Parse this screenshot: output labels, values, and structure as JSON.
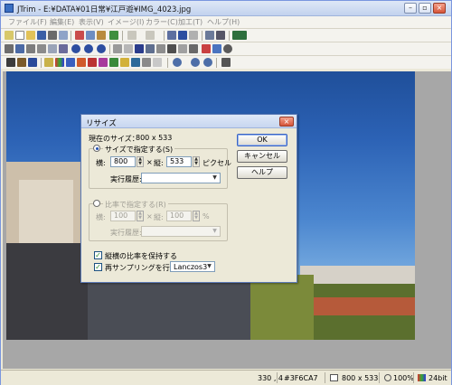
{
  "window": {
    "title": "JTrim - E:¥DATA¥01日常¥江戸遊¥IMG_4023.jpg"
  },
  "window_controls": {
    "minimize": "–",
    "maximize": "▫",
    "close": "×"
  },
  "menu": [
    "ファイル(F)",
    "編集(E)",
    "表示(V)",
    "イメージ(I)",
    "カラー(C)",
    "加工(T)",
    "ヘルプ(H)"
  ],
  "dialog": {
    "title": "リサイズ",
    "close": "×",
    "current_size_label": "現在のサイズ：",
    "current_size_value": "800 x 533",
    "size_group": {
      "radio_label": "サイズで指定する(S)",
      "width_label": "横:",
      "width_value": "800",
      "times": "×",
      "height_label": "縦:",
      "height_value": "533",
      "unit": "ピクセル",
      "history_label": "実行履歴:"
    },
    "ratio_group": {
      "radio_label": "比率で指定する(R)",
      "width_label": "横:",
      "width_value": "100",
      "times": "×",
      "height_label": "縦:",
      "height_value": "100",
      "unit": "%",
      "history_label": "実行履歴:"
    },
    "keep_ratio_label": "縦横の比率を保持する",
    "resample_label": "再サンプリングを行う",
    "resample_method": "Lanczos3",
    "buttons": {
      "ok": "OK",
      "cancel": "キャンセル",
      "help": "ヘルプ"
    }
  },
  "status": {
    "coords": "330 , 4",
    "color": "#3F6CA7",
    "size": "800 x 533",
    "zoom": "100%",
    "depth": "24bit"
  },
  "colors": {
    "sky": "#2c62b5",
    "workspace": "#a7a7a7",
    "chrome": "#ece9d8"
  }
}
